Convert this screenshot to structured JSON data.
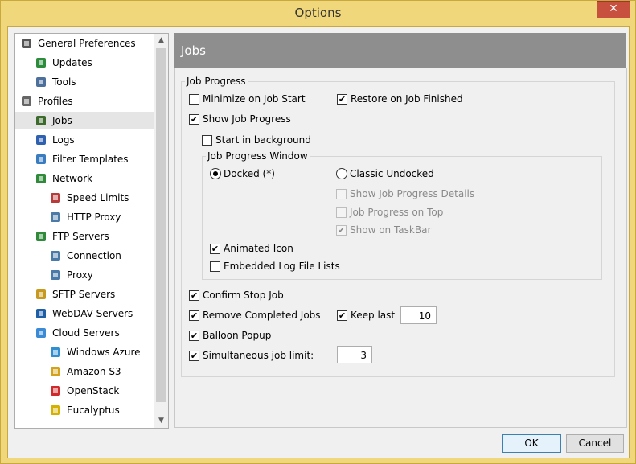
{
  "window": {
    "title": "Options",
    "close_label": "✕"
  },
  "tree": {
    "items": [
      {
        "label": "General Preferences",
        "icon": "gear-icon",
        "level": 0
      },
      {
        "label": "Updates",
        "icon": "globe-icon",
        "level": 1
      },
      {
        "label": "Tools",
        "icon": "tools-icon",
        "level": 1
      },
      {
        "label": "Profiles",
        "icon": "profile-icon",
        "level": 0
      },
      {
        "label": "Jobs",
        "icon": "jobs-icon",
        "level": 1,
        "selected": true
      },
      {
        "label": "Logs",
        "icon": "logs-icon",
        "level": 1
      },
      {
        "label": "Filter Templates",
        "icon": "filter-icon",
        "level": 1
      },
      {
        "label": "Network",
        "icon": "network-icon",
        "level": 1
      },
      {
        "label": "Speed Limits",
        "icon": "speed-icon",
        "level": 2
      },
      {
        "label": "HTTP Proxy",
        "icon": "proxy-icon",
        "level": 2
      },
      {
        "label": "FTP Servers",
        "icon": "ftp-icon",
        "level": 1
      },
      {
        "label": "Connection",
        "icon": "connection-icon",
        "level": 2
      },
      {
        "label": "Proxy",
        "icon": "proxy-icon",
        "level": 2
      },
      {
        "label": "SFTP Servers",
        "icon": "sftp-icon",
        "level": 1
      },
      {
        "label": "WebDAV Servers",
        "icon": "webdav-icon",
        "level": 1
      },
      {
        "label": "Cloud Servers",
        "icon": "cloud-icon",
        "level": 1
      },
      {
        "label": "Windows Azure",
        "icon": "azure-icon",
        "level": 2
      },
      {
        "label": "Amazon S3",
        "icon": "s3-icon",
        "level": 2
      },
      {
        "label": "OpenStack",
        "icon": "openstack-icon",
        "level": 2
      },
      {
        "label": "Eucalyptus",
        "icon": "eucalyptus-icon",
        "level": 2
      }
    ]
  },
  "panel": {
    "title": "Jobs",
    "job_progress_group": "Job Progress",
    "minimize_on_start": {
      "label": "Minimize on Job Start",
      "checked": false
    },
    "restore_on_finished": {
      "label": "Restore on Job Finished",
      "checked": true
    },
    "show_job_progress": {
      "label": "Show Job Progress",
      "checked": true
    },
    "start_in_background": {
      "label": "Start in background",
      "checked": false
    },
    "window_group": "Job Progress Window",
    "docked": {
      "label": "Docked (*)",
      "selected": true
    },
    "classic_undocked": {
      "label": "Classic Undocked",
      "selected": false
    },
    "show_details": {
      "label": "Show Job Progress Details",
      "checked": false,
      "disabled": true
    },
    "progress_on_top": {
      "label": "Job Progress on Top",
      "checked": false,
      "disabled": true
    },
    "show_on_taskbar": {
      "label": "Show on TaskBar",
      "checked": true,
      "disabled": true
    },
    "animated_icon": {
      "label": "Animated Icon",
      "checked": true
    },
    "embedded_log": {
      "label": "Embedded Log File Lists",
      "checked": false
    },
    "confirm_stop": {
      "label": "Confirm Stop Job",
      "checked": true
    },
    "remove_completed": {
      "label": "Remove Completed Jobs",
      "checked": true
    },
    "keep_last": {
      "label": "Keep last",
      "checked": true,
      "value": "10"
    },
    "balloon_popup": {
      "label": "Balloon Popup",
      "checked": true
    },
    "simultaneous_limit": {
      "label": "Simultaneous job limit:",
      "checked": true,
      "value": "3"
    }
  },
  "buttons": {
    "ok": "OK",
    "cancel": "Cancel"
  },
  "check_glyph": "✔"
}
